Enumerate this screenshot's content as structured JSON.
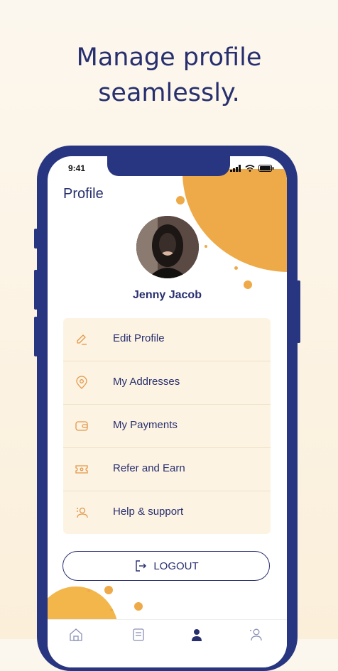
{
  "headline": {
    "line1": "Manage profile",
    "line2": "seamlessly."
  },
  "status_bar": {
    "time": "9:41"
  },
  "page": {
    "title": "Profile"
  },
  "user": {
    "name": "Jenny Jacob"
  },
  "menu": {
    "items": [
      {
        "label": "Edit Profile",
        "icon": "edit-icon"
      },
      {
        "label": "My Addresses",
        "icon": "location-pin-icon"
      },
      {
        "label": "My Payments",
        "icon": "wallet-icon"
      },
      {
        "label": "Refer and Earn",
        "icon": "ticket-icon"
      },
      {
        "label": "Help & support",
        "icon": "support-icon"
      }
    ]
  },
  "logout": {
    "label": "LOGOUT"
  },
  "bottom_nav": {
    "active": "profile",
    "items": [
      "home",
      "orders",
      "profile",
      "account"
    ]
  },
  "colors": {
    "navy": "#272f6e",
    "accent": "#eeaa48",
    "menu_bg": "#fdf3e3"
  }
}
